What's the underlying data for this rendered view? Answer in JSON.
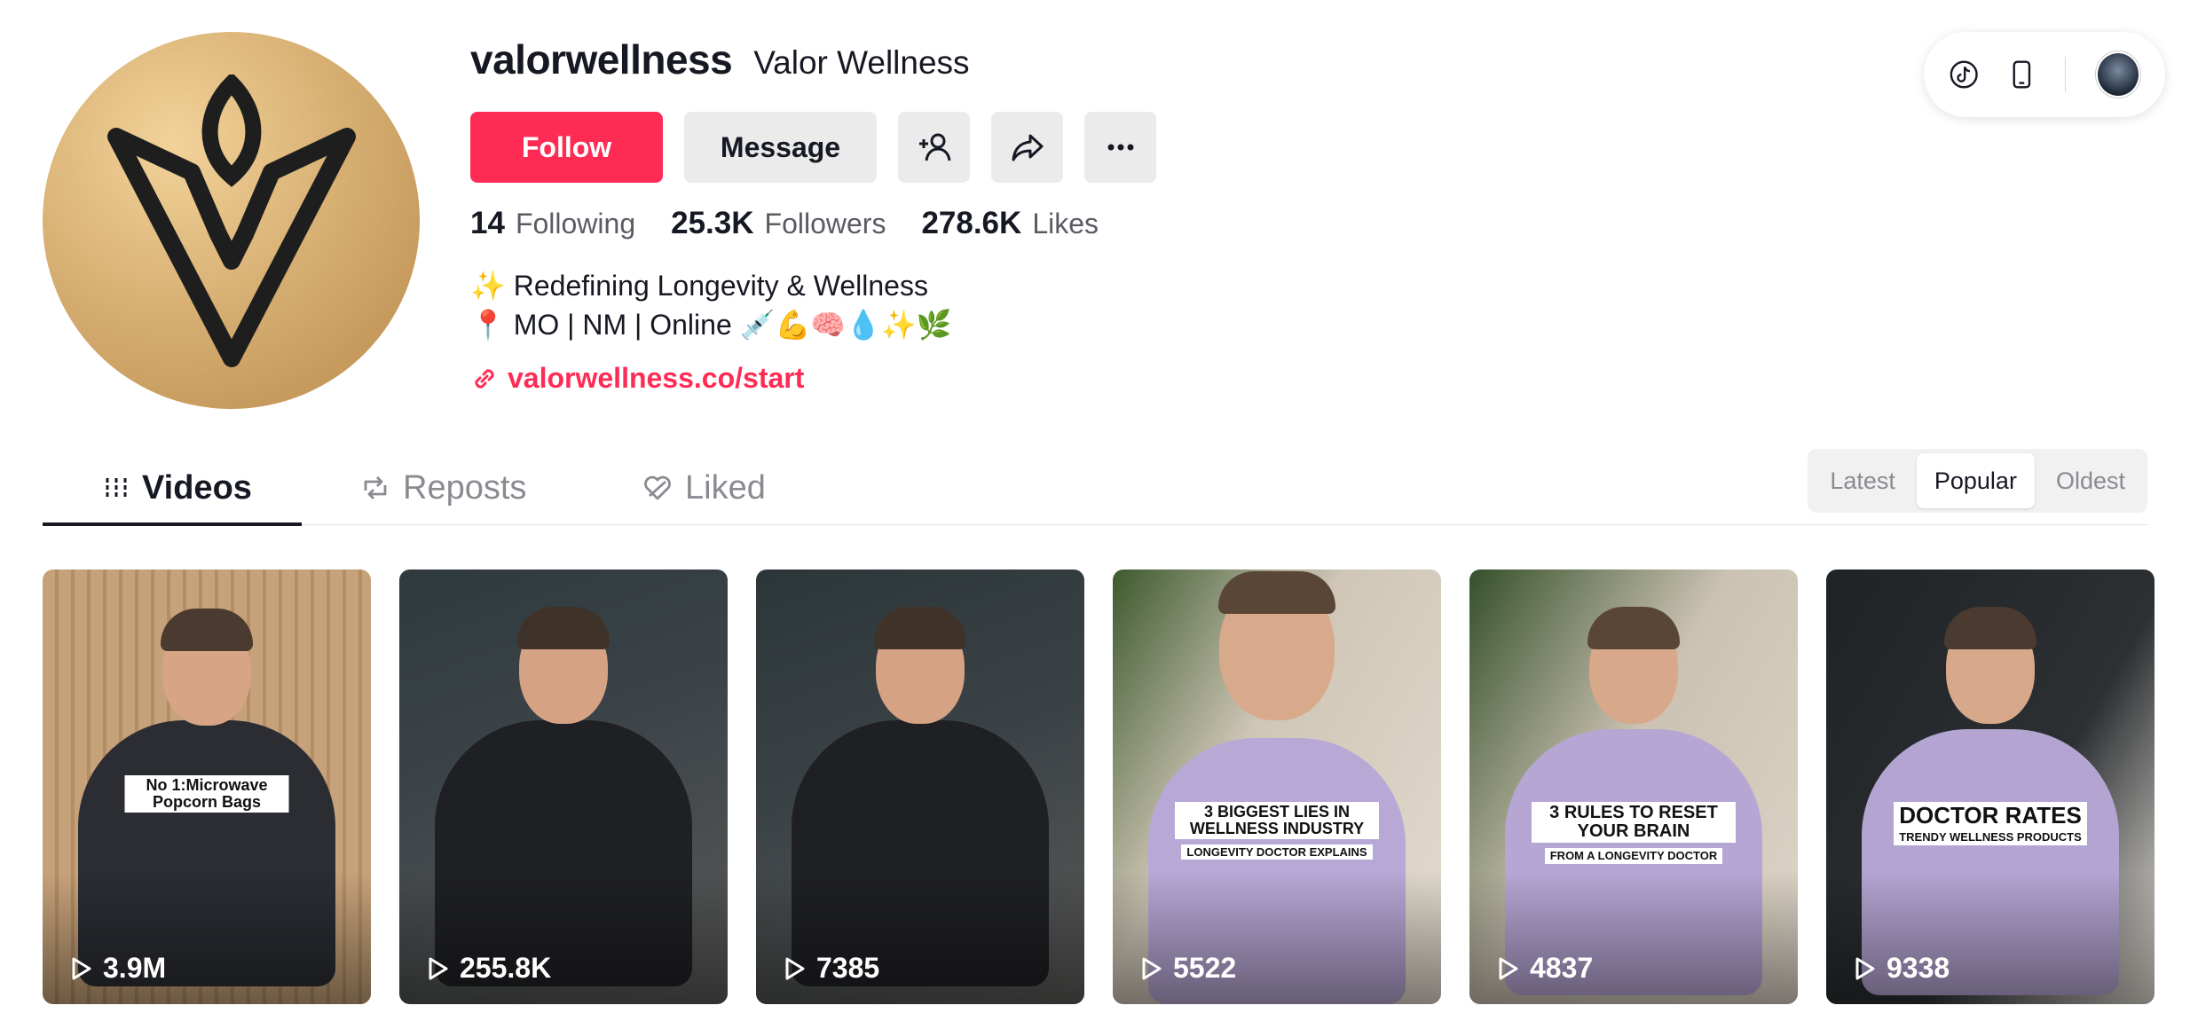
{
  "profile": {
    "username": "valorwellness",
    "nickname": "Valor Wellness",
    "bio_line1": "✨ Redefining Longevity & Wellness",
    "bio_line2": "📍 MO | NM | Online 💉💪🧠💧✨🌿",
    "link": "valorwellness.co/start",
    "brand_color": "#fe2c55"
  },
  "actions": {
    "follow_label": "Follow",
    "message_label": "Message"
  },
  "stats": {
    "following_count": "14",
    "following_label": "Following",
    "followers_count": "25.3K",
    "followers_label": "Followers",
    "likes_count": "278.6K",
    "likes_label": "Likes"
  },
  "tabs": [
    {
      "label": "Videos",
      "active": true
    },
    {
      "label": "Reposts",
      "active": false
    },
    {
      "label": "Liked",
      "active": false
    }
  ],
  "sort": [
    {
      "label": "Latest",
      "active": false
    },
    {
      "label": "Popular",
      "active": true
    },
    {
      "label": "Oldest",
      "active": false
    }
  ],
  "videos": [
    {
      "views": "3.9M",
      "caption_main": "No 1:Microwave Popcorn Bags",
      "caption_sub": ""
    },
    {
      "views": "255.8K",
      "caption_main": "",
      "caption_sub": ""
    },
    {
      "views": "7385",
      "caption_main": "",
      "caption_sub": ""
    },
    {
      "views": "5522",
      "caption_main": "3 BIGGEST LIES IN WELLNESS INDUSTRY",
      "caption_sub": "LONGEVITY DOCTOR EXPLAINS"
    },
    {
      "views": "4837",
      "caption_main": "3 RULES TO RESET YOUR BRAIN",
      "caption_sub": "FROM A LONGEVITY DOCTOR"
    },
    {
      "views": "9338",
      "caption_main": "DOCTOR RATES",
      "caption_sub": "TRENDY WELLNESS PRODUCTS"
    }
  ]
}
